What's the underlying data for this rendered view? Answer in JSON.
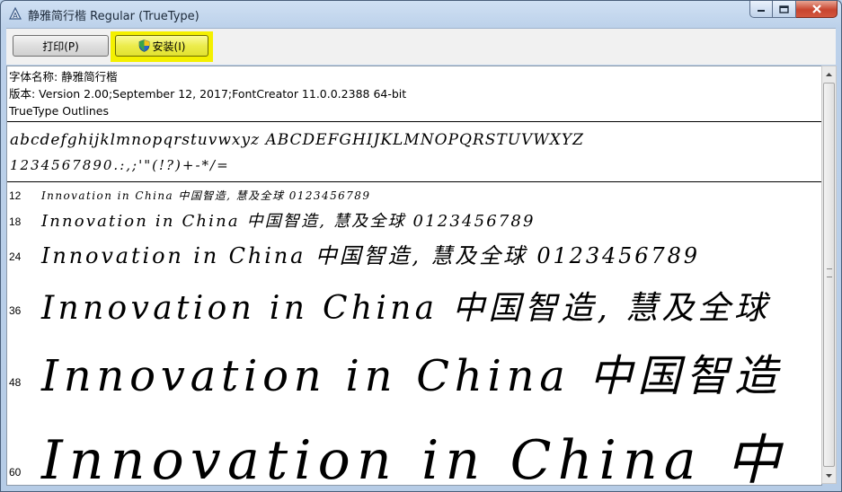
{
  "window": {
    "title": "静雅简行楷 Regular (TrueType)",
    "controls": {
      "minimize": "minimize",
      "maximize": "maximize",
      "close": "close"
    }
  },
  "toolbar": {
    "print_label": "打印(P)",
    "install_label": "安装(I)",
    "highlight_color": "#f4f000"
  },
  "info": {
    "font_name": "字体名称: 静雅简行楷",
    "version": "版本: Version 2.00;September 12, 2017;FontCreator 11.0.0.2388 64-bit",
    "outline": "TrueType Outlines"
  },
  "charset": {
    "letters": "abcdefghijklmnopqrstuvwxyz ABCDEFGHIJKLMNOPQRSTUVWXYZ",
    "digits": "1234567890.:,;'\"(!?)+-*/="
  },
  "samples": [
    {
      "size": "12",
      "text": "Innovation in China 中国智造, 慧及全球 0123456789"
    },
    {
      "size": "18",
      "text": "Innovation in China 中国智造, 慧及全球 0123456789"
    },
    {
      "size": "24",
      "text": "Innovation in China 中国智造, 慧及全球 0123456789"
    },
    {
      "size": "36",
      "text": "Innovation in China 中国智造, 慧及全球"
    },
    {
      "size": "48",
      "text": "Innovation in China 中国智造"
    },
    {
      "size": "60",
      "text": "Innovation in China 中"
    }
  ]
}
